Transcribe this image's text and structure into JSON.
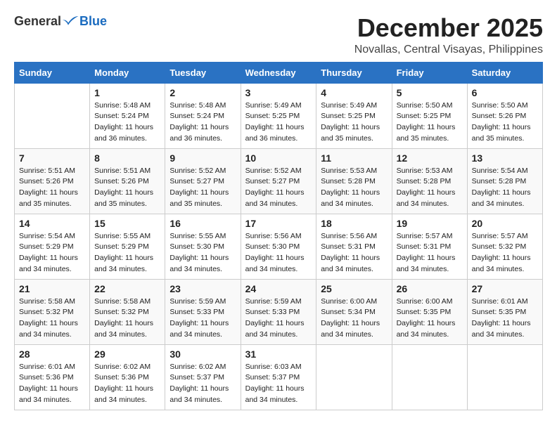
{
  "logo": {
    "general": "General",
    "blue": "Blue"
  },
  "header": {
    "month": "December 2025",
    "location": "Novallas, Central Visayas, Philippines"
  },
  "weekdays": [
    "Sunday",
    "Monday",
    "Tuesday",
    "Wednesday",
    "Thursday",
    "Friday",
    "Saturday"
  ],
  "weeks": [
    [
      {
        "day": "",
        "sunrise": "",
        "sunset": "",
        "daylight": ""
      },
      {
        "day": "1",
        "sunrise": "Sunrise: 5:48 AM",
        "sunset": "Sunset: 5:24 PM",
        "daylight": "Daylight: 11 hours and 36 minutes."
      },
      {
        "day": "2",
        "sunrise": "Sunrise: 5:48 AM",
        "sunset": "Sunset: 5:24 PM",
        "daylight": "Daylight: 11 hours and 36 minutes."
      },
      {
        "day": "3",
        "sunrise": "Sunrise: 5:49 AM",
        "sunset": "Sunset: 5:25 PM",
        "daylight": "Daylight: 11 hours and 36 minutes."
      },
      {
        "day": "4",
        "sunrise": "Sunrise: 5:49 AM",
        "sunset": "Sunset: 5:25 PM",
        "daylight": "Daylight: 11 hours and 35 minutes."
      },
      {
        "day": "5",
        "sunrise": "Sunrise: 5:50 AM",
        "sunset": "Sunset: 5:25 PM",
        "daylight": "Daylight: 11 hours and 35 minutes."
      },
      {
        "day": "6",
        "sunrise": "Sunrise: 5:50 AM",
        "sunset": "Sunset: 5:26 PM",
        "daylight": "Daylight: 11 hours and 35 minutes."
      }
    ],
    [
      {
        "day": "7",
        "sunrise": "Sunrise: 5:51 AM",
        "sunset": "Sunset: 5:26 PM",
        "daylight": "Daylight: 11 hours and 35 minutes."
      },
      {
        "day": "8",
        "sunrise": "Sunrise: 5:51 AM",
        "sunset": "Sunset: 5:26 PM",
        "daylight": "Daylight: 11 hours and 35 minutes."
      },
      {
        "day": "9",
        "sunrise": "Sunrise: 5:52 AM",
        "sunset": "Sunset: 5:27 PM",
        "daylight": "Daylight: 11 hours and 35 minutes."
      },
      {
        "day": "10",
        "sunrise": "Sunrise: 5:52 AM",
        "sunset": "Sunset: 5:27 PM",
        "daylight": "Daylight: 11 hours and 34 minutes."
      },
      {
        "day": "11",
        "sunrise": "Sunrise: 5:53 AM",
        "sunset": "Sunset: 5:28 PM",
        "daylight": "Daylight: 11 hours and 34 minutes."
      },
      {
        "day": "12",
        "sunrise": "Sunrise: 5:53 AM",
        "sunset": "Sunset: 5:28 PM",
        "daylight": "Daylight: 11 hours and 34 minutes."
      },
      {
        "day": "13",
        "sunrise": "Sunrise: 5:54 AM",
        "sunset": "Sunset: 5:28 PM",
        "daylight": "Daylight: 11 hours and 34 minutes."
      }
    ],
    [
      {
        "day": "14",
        "sunrise": "Sunrise: 5:54 AM",
        "sunset": "Sunset: 5:29 PM",
        "daylight": "Daylight: 11 hours and 34 minutes."
      },
      {
        "day": "15",
        "sunrise": "Sunrise: 5:55 AM",
        "sunset": "Sunset: 5:29 PM",
        "daylight": "Daylight: 11 hours and 34 minutes."
      },
      {
        "day": "16",
        "sunrise": "Sunrise: 5:55 AM",
        "sunset": "Sunset: 5:30 PM",
        "daylight": "Daylight: 11 hours and 34 minutes."
      },
      {
        "day": "17",
        "sunrise": "Sunrise: 5:56 AM",
        "sunset": "Sunset: 5:30 PM",
        "daylight": "Daylight: 11 hours and 34 minutes."
      },
      {
        "day": "18",
        "sunrise": "Sunrise: 5:56 AM",
        "sunset": "Sunset: 5:31 PM",
        "daylight": "Daylight: 11 hours and 34 minutes."
      },
      {
        "day": "19",
        "sunrise": "Sunrise: 5:57 AM",
        "sunset": "Sunset: 5:31 PM",
        "daylight": "Daylight: 11 hours and 34 minutes."
      },
      {
        "day": "20",
        "sunrise": "Sunrise: 5:57 AM",
        "sunset": "Sunset: 5:32 PM",
        "daylight": "Daylight: 11 hours and 34 minutes."
      }
    ],
    [
      {
        "day": "21",
        "sunrise": "Sunrise: 5:58 AM",
        "sunset": "Sunset: 5:32 PM",
        "daylight": "Daylight: 11 hours and 34 minutes."
      },
      {
        "day": "22",
        "sunrise": "Sunrise: 5:58 AM",
        "sunset": "Sunset: 5:32 PM",
        "daylight": "Daylight: 11 hours and 34 minutes."
      },
      {
        "day": "23",
        "sunrise": "Sunrise: 5:59 AM",
        "sunset": "Sunset: 5:33 PM",
        "daylight": "Daylight: 11 hours and 34 minutes."
      },
      {
        "day": "24",
        "sunrise": "Sunrise: 5:59 AM",
        "sunset": "Sunset: 5:33 PM",
        "daylight": "Daylight: 11 hours and 34 minutes."
      },
      {
        "day": "25",
        "sunrise": "Sunrise: 6:00 AM",
        "sunset": "Sunset: 5:34 PM",
        "daylight": "Daylight: 11 hours and 34 minutes."
      },
      {
        "day": "26",
        "sunrise": "Sunrise: 6:00 AM",
        "sunset": "Sunset: 5:35 PM",
        "daylight": "Daylight: 11 hours and 34 minutes."
      },
      {
        "day": "27",
        "sunrise": "Sunrise: 6:01 AM",
        "sunset": "Sunset: 5:35 PM",
        "daylight": "Daylight: 11 hours and 34 minutes."
      }
    ],
    [
      {
        "day": "28",
        "sunrise": "Sunrise: 6:01 AM",
        "sunset": "Sunset: 5:36 PM",
        "daylight": "Daylight: 11 hours and 34 minutes."
      },
      {
        "day": "29",
        "sunrise": "Sunrise: 6:02 AM",
        "sunset": "Sunset: 5:36 PM",
        "daylight": "Daylight: 11 hours and 34 minutes."
      },
      {
        "day": "30",
        "sunrise": "Sunrise: 6:02 AM",
        "sunset": "Sunset: 5:37 PM",
        "daylight": "Daylight: 11 hours and 34 minutes."
      },
      {
        "day": "31",
        "sunrise": "Sunrise: 6:03 AM",
        "sunset": "Sunset: 5:37 PM",
        "daylight": "Daylight: 11 hours and 34 minutes."
      },
      {
        "day": "",
        "sunrise": "",
        "sunset": "",
        "daylight": ""
      },
      {
        "day": "",
        "sunrise": "",
        "sunset": "",
        "daylight": ""
      },
      {
        "day": "",
        "sunrise": "",
        "sunset": "",
        "daylight": ""
      }
    ]
  ]
}
